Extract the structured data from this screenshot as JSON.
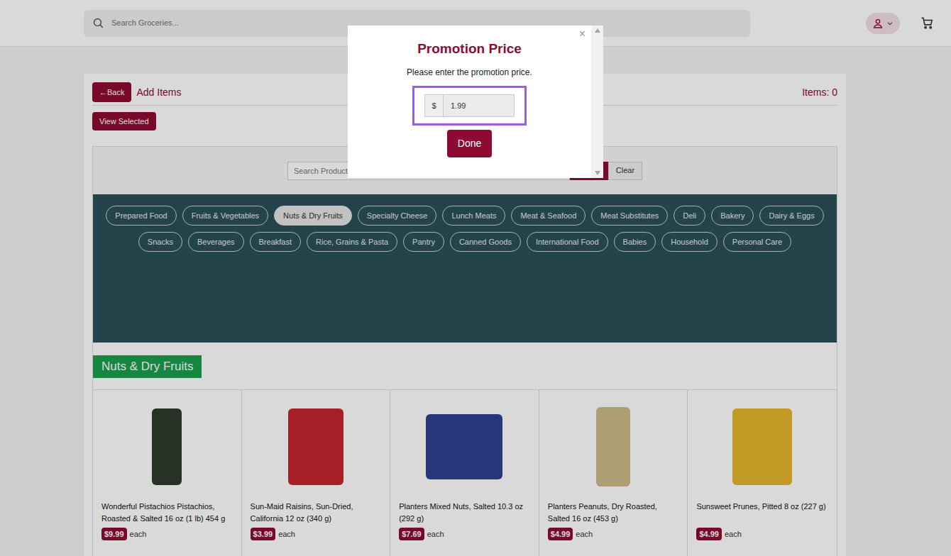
{
  "header": {
    "search_placeholder": "Search Groceries..."
  },
  "toolbar": {
    "back_icon": "←",
    "back_label": "Back",
    "title": "Add Items",
    "items_count": "Items: 0",
    "view_selected": "View Selected"
  },
  "filter": {
    "search_placeholder": "Search Product",
    "clear": "Clear"
  },
  "categories": [
    {
      "label": "Prepared Food",
      "selected": false
    },
    {
      "label": "Fruits & Vegetables",
      "selected": false
    },
    {
      "label": "Nuts & Dry Fruits",
      "selected": true
    },
    {
      "label": "Specialty Cheese",
      "selected": false
    },
    {
      "label": "Lunch Meats",
      "selected": false
    },
    {
      "label": "Meat & Seafood",
      "selected": false
    },
    {
      "label": "Meat Substitutes",
      "selected": false
    },
    {
      "label": "Deli",
      "selected": false
    },
    {
      "label": "Bakery",
      "selected": false
    },
    {
      "label": "Dairy & Eggs",
      "selected": false
    },
    {
      "label": "Snacks",
      "selected": false
    },
    {
      "label": "Beverages",
      "selected": false
    },
    {
      "label": "Breakfast",
      "selected": false
    },
    {
      "label": "Rice, Grains & Pasta",
      "selected": false
    },
    {
      "label": "Pantry",
      "selected": false
    },
    {
      "label": "Canned Goods",
      "selected": false
    },
    {
      "label": "International Food",
      "selected": false
    },
    {
      "label": "Babies",
      "selected": false
    },
    {
      "label": "Household",
      "selected": false
    },
    {
      "label": "Personal Care",
      "selected": false
    }
  ],
  "section": {
    "title": "Nuts & Dry Fruits"
  },
  "products": [
    {
      "name": "Wonderful Pistachios Pistachios, Roasted & Salted 16 oz (1 lb) 454 g",
      "price": "$9.99",
      "unit": "each"
    },
    {
      "name": "Sun-Maid Raisins, Sun-Dried, California 12 oz (340 g)",
      "price": "$3.99",
      "unit": "each"
    },
    {
      "name": "Planters Mixed Nuts, Salted 10.3 oz (292 g)",
      "price": "$7.69",
      "unit": "each"
    },
    {
      "name": "Planters Peanuts, Dry Roasted, Salted 16 oz (453 g)",
      "price": "$4.99",
      "unit": "each"
    },
    {
      "name": "Sunsweet Prunes, Pitted 8 oz (227 g)",
      "price": "$4.99",
      "unit": "each"
    }
  ],
  "modal": {
    "title": "Promotion Price",
    "message": "Please enter the promotion price.",
    "currency": "$",
    "price_value": "1.99",
    "input_focused": true,
    "done": "Done",
    "close": "×"
  }
}
